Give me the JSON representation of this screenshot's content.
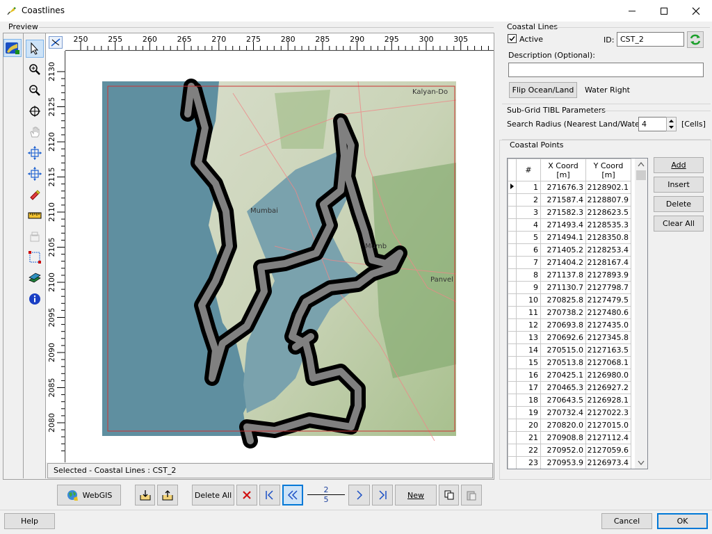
{
  "window": {
    "title": "Coastlines"
  },
  "preview": {
    "label": "Preview",
    "ruler_x": [
      "250",
      "255",
      "260",
      "265",
      "270",
      "275",
      "280",
      "285",
      "290",
      "295",
      "300",
      "305"
    ],
    "ruler_y": [
      "2130",
      "2125",
      "2120",
      "2115",
      "2110",
      "2105",
      "2100",
      "2095",
      "2090",
      "2085",
      "2080"
    ],
    "map_labels": [
      "Kalyan-Do",
      "Mumbai",
      "Panvel",
      "Mumb"
    ],
    "status": "Selected - Coastal Lines : CST_2"
  },
  "coastal_lines": {
    "group_title": "Coastal Lines",
    "active_label": "Active",
    "active_checked": true,
    "id_label": "ID:",
    "id_value": "CST_2",
    "description_label": "Description (Optional):",
    "description_value": "",
    "flip_button": "Flip Ocean/Land",
    "water_side": "Water Right"
  },
  "tibl": {
    "group_title": "Sub-Grid TIBL Parameters",
    "radius_label": "Search Radius (Nearest Land/Water):",
    "radius_value": "4",
    "units": "[Cells]"
  },
  "points": {
    "group_title": "Coastal Points",
    "columns": [
      "#",
      "X Coord\n[m]",
      "Y Coord\n[m]"
    ],
    "col_num": "#",
    "col_x_1": "X Coord",
    "col_x_2": "[m]",
    "col_y_1": "Y Coord",
    "col_y_2": "[m]",
    "rows": [
      [
        "1",
        "271676.3",
        "2128902.1"
      ],
      [
        "2",
        "271587.4",
        "2128807.9"
      ],
      [
        "3",
        "271582.3",
        "2128623.5"
      ],
      [
        "4",
        "271493.4",
        "2128535.3"
      ],
      [
        "5",
        "271494.1",
        "2128350.8"
      ],
      [
        "6",
        "271405.2",
        "2128253.4"
      ],
      [
        "7",
        "271404.2",
        "2128167.4"
      ],
      [
        "8",
        "271137.8",
        "2127893.9"
      ],
      [
        "9",
        "271130.7",
        "2127798.7"
      ],
      [
        "10",
        "270825.8",
        "2127479.5"
      ],
      [
        "11",
        "270738.2",
        "2127480.6"
      ],
      [
        "12",
        "270693.8",
        "2127435.0"
      ],
      [
        "13",
        "270692.6",
        "2127345.8"
      ],
      [
        "14",
        "270515.0",
        "2127163.5"
      ],
      [
        "15",
        "270513.8",
        "2127068.1"
      ],
      [
        "16",
        "270425.1",
        "2126980.0"
      ],
      [
        "17",
        "270465.3",
        "2126927.2"
      ],
      [
        "18",
        "270643.5",
        "2126928.1"
      ],
      [
        "19",
        "270732.4",
        "2127022.3"
      ],
      [
        "20",
        "270820.0",
        "2127015.0"
      ],
      [
        "21",
        "270908.8",
        "2127112.4"
      ],
      [
        "22",
        "270952.0",
        "2127059.6"
      ],
      [
        "23",
        "270953.9",
        "2126973.4"
      ]
    ],
    "add": "Add",
    "insert": "Insert",
    "delete": "Delete",
    "clear_all": "Clear All"
  },
  "bottom": {
    "webgis": "WebGIS",
    "delete_all": "Delete All",
    "page_current": "2",
    "page_total": "5",
    "new": "New"
  },
  "footer": {
    "help": "Help",
    "cancel": "Cancel",
    "ok": "OK"
  },
  "icons": {
    "app": "app-feather-icon",
    "minimize": "minimize-icon",
    "maximize": "maximize-icon",
    "close": "close-icon",
    "refresh": "refresh-icon",
    "webgis": "globe-icon",
    "import": "import-icon",
    "export": "export-icon",
    "delete": "red-x-icon",
    "first": "first-icon",
    "prev": "prev-icon",
    "next": "next-icon",
    "last": "last-icon",
    "copy": "copy-icon",
    "paste": "paste-icon"
  },
  "colors": {
    "accent": "#0078d7",
    "map_water": "#5b8fa0",
    "coast_line": "#808080",
    "boundary": "#cc3333"
  }
}
